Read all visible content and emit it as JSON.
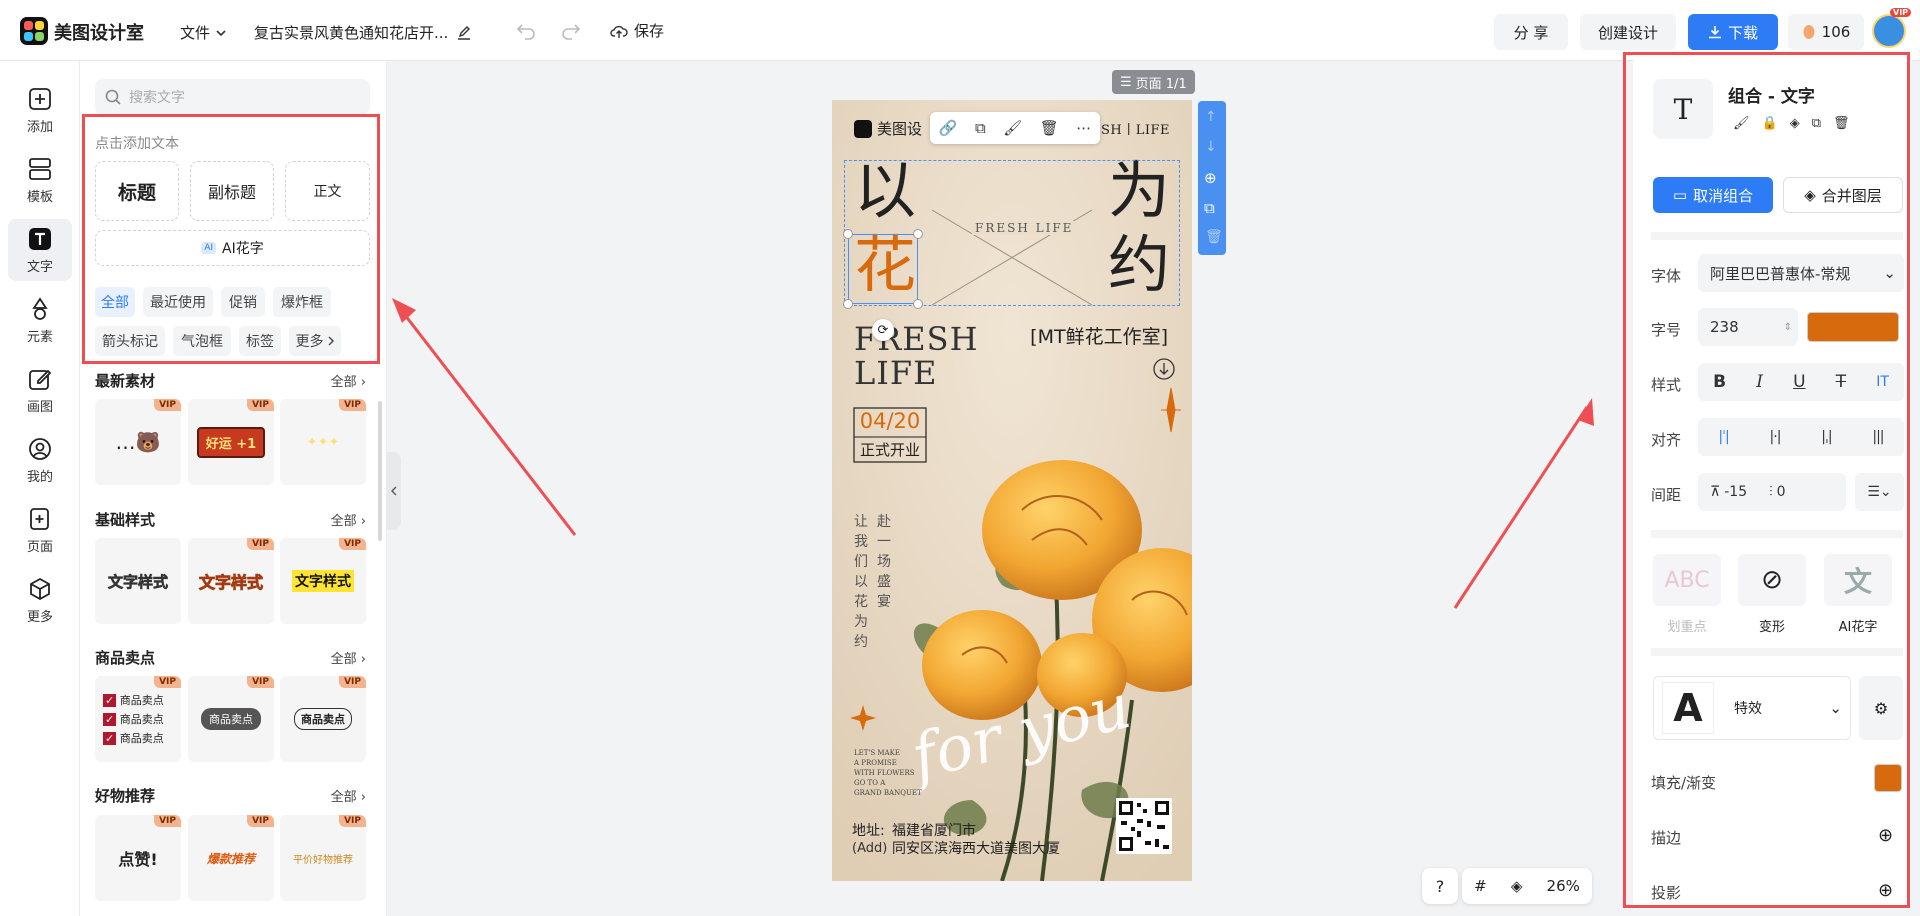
{
  "app": {
    "name": "美图设计室"
  },
  "topbar": {
    "file_menu": "文件",
    "doc_title": "复古实景风黄色通知花店开...",
    "save": "保存",
    "share": "分 享",
    "create": "创建设计",
    "download": "下载",
    "credits": "106",
    "vip_badge": "VIP"
  },
  "rail": {
    "items": [
      "添加",
      "模板",
      "文字",
      "元素",
      "画图",
      "我的",
      "页面",
      "更多"
    ]
  },
  "panel": {
    "search_placeholder": "搜索文字",
    "add_text_hint": "点击添加文本",
    "title": "标题",
    "subtitle": "副标题",
    "body": "正文",
    "ai_badge": "AI",
    "ai_text": "AI花字",
    "chips": [
      "全部",
      "最近使用",
      "促销",
      "爆炸框",
      "箭头标记",
      "气泡框",
      "标签",
      "更多"
    ],
    "all_label": "全部",
    "vip_label": "VIP",
    "sections": [
      "最新素材",
      "基础样式",
      "商品卖点",
      "好物推荐"
    ],
    "tile_texts": {
      "haoyun": "好运 +1",
      "wenzi": "文字样式",
      "maidian": "商品卖点",
      "dianzan": "点赞!",
      "baokuan": "爆款推荐",
      "pingjia": "平价好物推荐"
    }
  },
  "canvas": {
    "page_indicator": "页面 1/1",
    "zoom": "26%"
  },
  "poster": {
    "brand": "美图设",
    "header_right": "FRESH丨LIFE",
    "char_yi": "以",
    "char_hua": "花",
    "char_wei": "为",
    "char_yue": "约",
    "mid_text": "FRESH LIFE",
    "fresh": "FRESH",
    "life": "LIFE",
    "studio": "[MT鲜花工作室]",
    "date": "04/20",
    "opening": "正式开业",
    "vertical_left": "让我们以花为约",
    "vertical_right": "赴一场盛宴",
    "for_you": "for you",
    "small_lines": [
      "LET'S MAKE",
      "A PROMISE",
      "WITH FLOWERS",
      "GO TO A",
      "GRAND BANQUET"
    ],
    "address_label": "地址:",
    "address_en": "(Add)",
    "address_line1": "福建省厦门市",
    "address_line2": "同安区滨海西大道美图大厦"
  },
  "right": {
    "group_title": "组合 - 文字",
    "ungroup": "取消组合",
    "merge": "合并图层",
    "font_label": "字体",
    "font_value": "阿里巴巴普惠体-常规",
    "size_label": "字号",
    "size_value": "238",
    "color": "#d86a0e",
    "style_label": "样式",
    "align_label": "对齐",
    "spacing_label": "间距",
    "letter_spacing": "-15",
    "line_spacing": "0",
    "effects": [
      {
        "label": "划重点",
        "glyph": "ABC"
      },
      {
        "label": "变形",
        "glyph": "⊘"
      },
      {
        "label": "AI花字",
        "glyph": "文"
      }
    ],
    "effect_label": "特效",
    "effect_glyph": "A",
    "fill_label": "填充/渐变",
    "stroke_label": "描边",
    "shadow_label": "投影"
  },
  "colors": {
    "accent": "#2d7cf6",
    "annotation": "#ef4f52",
    "brand_orange": "#d86a0e"
  }
}
